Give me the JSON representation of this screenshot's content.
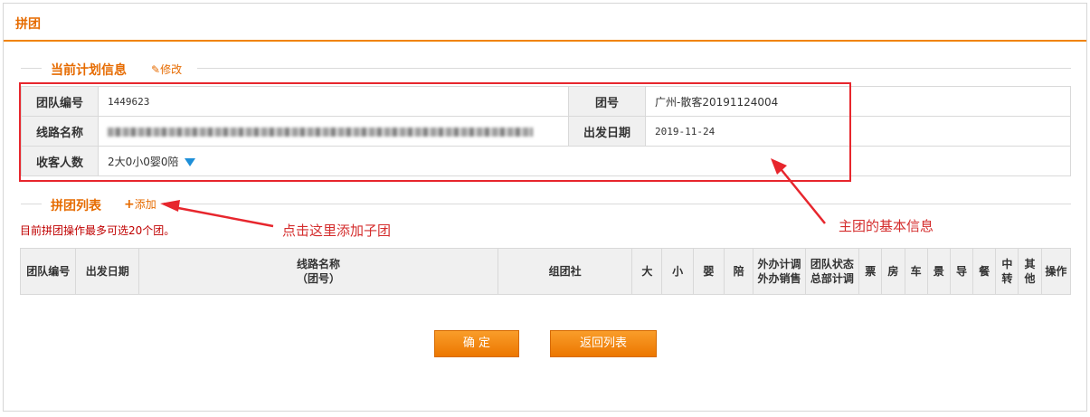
{
  "page": {
    "title": "拼团"
  },
  "plan_section": {
    "title": "当前计划信息",
    "edit_label": "修改"
  },
  "plan_info": {
    "team_no_label": "团队编号",
    "team_no": "1449623",
    "group_no_label": "团号",
    "group_no": "广州-散客20191124004",
    "route_label": "线路名称",
    "depart_label": "出发日期",
    "depart_date": "2019-11-24",
    "guests_label": "收客人数",
    "guests": "2大0小0婴0陪"
  },
  "group_section": {
    "title": "拼团列表",
    "add_label": "添加",
    "note": "目前拼团操作最多可选20个团。"
  },
  "table": {
    "headers": [
      "团队编号",
      "出发日期",
      "线路名称\n（团号）",
      "组团社",
      "大",
      "小",
      "婴",
      "陪",
      "外办计调\n外办销售",
      "团队状态\n总部计调",
      "票",
      "房",
      "车",
      "景",
      "导",
      "餐",
      "中\n转",
      "其\n他",
      "操作"
    ]
  },
  "annotations": {
    "add_hint": "点击这里添加子团",
    "main_info_hint": "主团的基本信息"
  },
  "buttons": {
    "confirm": "确 定",
    "back": "返回列表"
  },
  "colors": {
    "accent": "#f08300",
    "annotation_red": "#e7262d",
    "dropdown_blue": "#1e8fd8"
  }
}
